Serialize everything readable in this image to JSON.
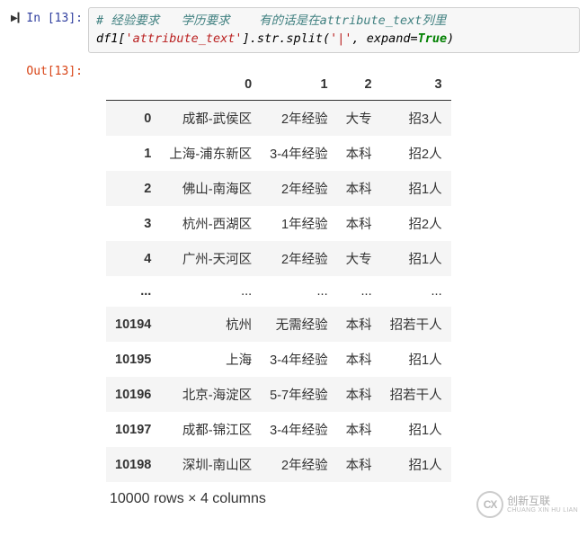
{
  "prompts": {
    "in_label": "In  [13]:",
    "out_label": "Out[13]:"
  },
  "code": {
    "comment": "# 经验要求   学历要求    有的话是在attribute_text列里",
    "line2_a": "df1[",
    "line2_str1": "'attribute_text'",
    "line2_b": "].str.split(",
    "line2_str2": "'|'",
    "line2_c": ", expand=",
    "line2_bool": "True",
    "line2_d": ")"
  },
  "table": {
    "columns": [
      "0",
      "1",
      "2",
      "3"
    ],
    "rows": [
      {
        "index": "0",
        "c0": "成都-武侯区",
        "c1": "2年经验",
        "c2": "大专",
        "c3": "招3人"
      },
      {
        "index": "1",
        "c0": "上海-浦东新区",
        "c1": "3-4年经验",
        "c2": "本科",
        "c3": "招2人"
      },
      {
        "index": "2",
        "c0": "佛山-南海区",
        "c1": "2年经验",
        "c2": "本科",
        "c3": "招1人"
      },
      {
        "index": "3",
        "c0": "杭州-西湖区",
        "c1": "1年经验",
        "c2": "本科",
        "c3": "招2人"
      },
      {
        "index": "4",
        "c0": "广州-天河区",
        "c1": "2年经验",
        "c2": "大专",
        "c3": "招1人"
      },
      {
        "index": "...",
        "c0": "...",
        "c1": "...",
        "c2": "...",
        "c3": "..."
      },
      {
        "index": "10194",
        "c0": "杭州",
        "c1": "无需经验",
        "c2": "本科",
        "c3": "招若干人"
      },
      {
        "index": "10195",
        "c0": "上海",
        "c1": "3-4年经验",
        "c2": "本科",
        "c3": "招1人"
      },
      {
        "index": "10196",
        "c0": "北京-海淀区",
        "c1": "5-7年经验",
        "c2": "本科",
        "c3": "招若干人"
      },
      {
        "index": "10197",
        "c0": "成都-锦江区",
        "c1": "3-4年经验",
        "c2": "本科",
        "c3": "招1人"
      },
      {
        "index": "10198",
        "c0": "深圳-南山区",
        "c1": "2年经验",
        "c2": "本科",
        "c3": "招1人"
      }
    ],
    "shape_line": "10000 rows × 4 columns"
  },
  "watermark": {
    "abbrev": "CX",
    "cn": "创新互联",
    "py": "CHUANG XIN HU LIAN"
  }
}
